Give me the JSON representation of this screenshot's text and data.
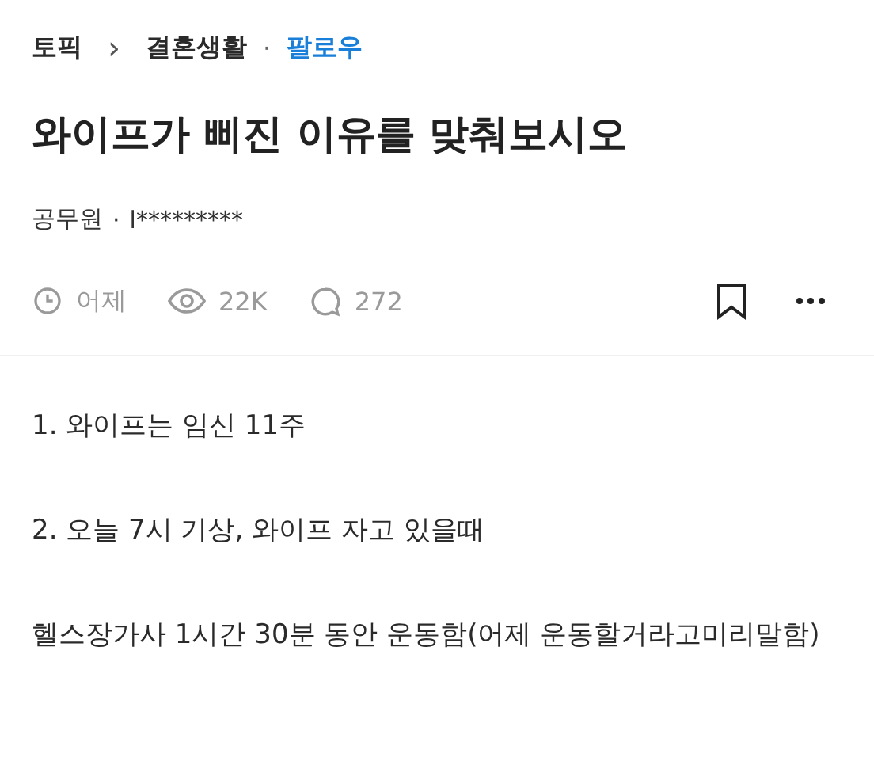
{
  "breadcrumb": {
    "topic": "토픽",
    "separator": "›",
    "category": "결혼생활",
    "dot": "·",
    "follow": "팔로우"
  },
  "title": "와이프가 삐진 이유를 맞춰보시오",
  "author": {
    "job": "공무원",
    "dot": "·",
    "name": "l*********"
  },
  "stats": {
    "time": "어제",
    "views": "22K",
    "comments": "272"
  },
  "bookmarked": false,
  "paragraphs": [
    "1. 와이프는 임신 11주",
    "2. 오늘 7시 기상, 와이프 자고 있을때",
    "헬스장가사 1시간 30분 동안 운동함(어제 운동할거라고미리말함)"
  ]
}
